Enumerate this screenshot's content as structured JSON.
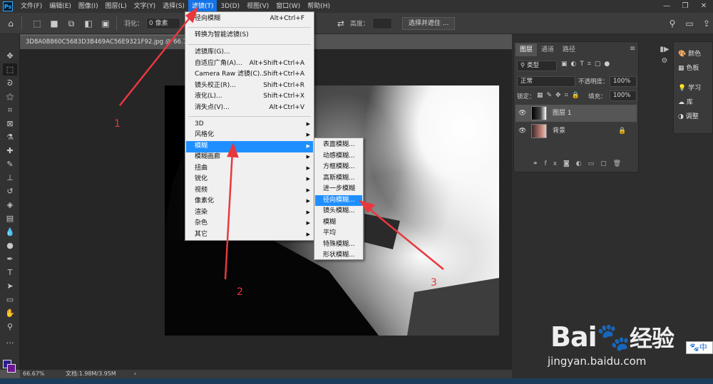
{
  "menubar": {
    "items": [
      "文件(F)",
      "编辑(E)",
      "图像(I)",
      "图层(L)",
      "文字(Y)",
      "选择(S)",
      "滤镜(T)",
      "3D(D)",
      "视图(V)",
      "窗口(W)",
      "帮助(H)"
    ],
    "active_index": 6,
    "logo": "Ps"
  },
  "options_bar": {
    "feather_label": "羽化：",
    "feather_value": "0 像素",
    "height_label": "高度：",
    "select_mask_button": "选择并遮住 ..."
  },
  "document": {
    "tab_title": "3D8A0B860C5683D3B469AC56E9321F92.jpg @ 66.7% (图层 1, RGB/8)",
    "zoom": "66.67%",
    "doc_info": "文档:1.98M/3.95M"
  },
  "filter_menu": {
    "items": [
      {
        "label": "径向模糊",
        "shortcut": "Alt+Ctrl+F"
      },
      {
        "label": "转换为智能滤镜(S)",
        "shortcut": ""
      },
      {
        "label": "滤镜库(G)...",
        "shortcut": ""
      },
      {
        "label": "自适应广角(A)...",
        "shortcut": "Alt+Shift+Ctrl+A"
      },
      {
        "label": "Camera Raw 滤镜(C)...",
        "shortcut": "Shift+Ctrl+A"
      },
      {
        "label": "镜头校正(R)...",
        "shortcut": "Shift+Ctrl+R"
      },
      {
        "label": "液化(L)...",
        "shortcut": "Shift+Ctrl+X"
      },
      {
        "label": "消失点(V)...",
        "shortcut": "Alt+Ctrl+V"
      },
      {
        "label": "3D",
        "shortcut": ""
      },
      {
        "label": "风格化",
        "shortcut": ""
      },
      {
        "label": "模糊",
        "shortcut": ""
      },
      {
        "label": "模糊画廊",
        "shortcut": ""
      },
      {
        "label": "扭曲",
        "shortcut": ""
      },
      {
        "label": "锐化",
        "shortcut": ""
      },
      {
        "label": "视频",
        "shortcut": ""
      },
      {
        "label": "像素化",
        "shortcut": ""
      },
      {
        "label": "渲染",
        "shortcut": ""
      },
      {
        "label": "杂色",
        "shortcut": ""
      },
      {
        "label": "其它",
        "shortcut": ""
      }
    ]
  },
  "blur_submenu": {
    "items": [
      "表面模糊...",
      "动感模糊...",
      "方框模糊...",
      "高斯模糊...",
      "进一步模糊",
      "径向模糊...",
      "镜头模糊...",
      "模糊",
      "平均",
      "特殊模糊...",
      "形状模糊..."
    ],
    "highlighted_index": 5
  },
  "layers_panel": {
    "tabs": [
      "图层",
      "通道",
      "路径"
    ],
    "kind_filter": "类型",
    "blend_mode": "正常",
    "opacity_label": "不透明度：",
    "opacity_value": "100%",
    "lock_label": "锁定：",
    "fill_label": "填充：",
    "fill_value": "100%",
    "layers": [
      {
        "name": "图层 1",
        "selected": true
      },
      {
        "name": "背景",
        "locked": true
      }
    ]
  },
  "side_panel": {
    "items": [
      "颜色",
      "色板",
      "学习",
      "库",
      "调整"
    ]
  },
  "annotations": {
    "labels": [
      "1",
      "2",
      "3"
    ],
    "color": "#e8383d"
  },
  "watermark": {
    "text": "Bai",
    "text2": "经验",
    "url": "jingyan.baidu.com"
  },
  "ime": "中"
}
